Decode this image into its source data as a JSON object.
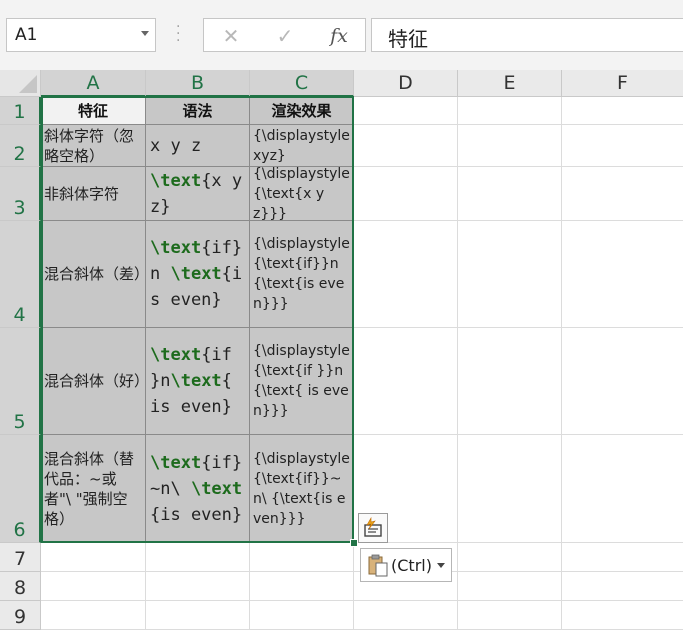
{
  "name_box": {
    "value": "A1"
  },
  "formula_bar": {
    "cancel_icon": "✕",
    "enter_icon": "✓",
    "fx_label": "fx",
    "content": "特征"
  },
  "columns": [
    "A",
    "B",
    "C",
    "D",
    "E",
    "F"
  ],
  "rows": [
    "1",
    "2",
    "3",
    "4",
    "5",
    "6",
    "7",
    "8",
    "9"
  ],
  "table": {
    "headers": [
      "特征",
      "语法",
      "渲染效果"
    ],
    "rows": [
      {
        "feature": "斜体字符（忽略空格）",
        "syntax": [
          {
            "t": "x y z"
          }
        ],
        "render": "{\\displaystyle xyz}"
      },
      {
        "feature": "非斜体字符",
        "syntax": [
          {
            "t": "\\text",
            "kw": true
          },
          {
            "t": "{x y z}"
          }
        ],
        "render": "{\\displaystyle {\\text{x y z}}}"
      },
      {
        "feature": "混合斜体（差）",
        "syntax": [
          {
            "t": "\\text",
            "kw": true
          },
          {
            "t": "{if} n "
          },
          {
            "t": "\\text",
            "kw": true
          },
          {
            "t": "{is even}"
          }
        ],
        "render": "{\\displaystyle {\\text{if}}n{\\text{is even}}}"
      },
      {
        "feature": "混合斜体（好）",
        "syntax": [
          {
            "t": "\\text",
            "kw": true
          },
          {
            "t": "{if }n"
          },
          {
            "t": "\\text",
            "kw": true
          },
          {
            "t": "{ is even}"
          }
        ],
        "render": "{\\displaystyle {\\text{if }}n{\\text{ is even}}}"
      },
      {
        "feature": "混合斜体（替代品：~或者\"\\ \"强制空格）",
        "syntax": [
          {
            "t": "\\text",
            "kw": true
          },
          {
            "t": "{if}~n\\ "
          },
          {
            "t": "\\text",
            "kw": true
          },
          {
            "t": "{is even}"
          }
        ],
        "render": "{\\displaystyle {\\text{if}}~n\\ {\\text{is even}}}"
      }
    ]
  },
  "paste_options": {
    "label": "(Ctrl)"
  },
  "colors": {
    "selection": "#217346",
    "keyword": "#1d6b1d",
    "cell_fill": "#c7c7c7"
  }
}
